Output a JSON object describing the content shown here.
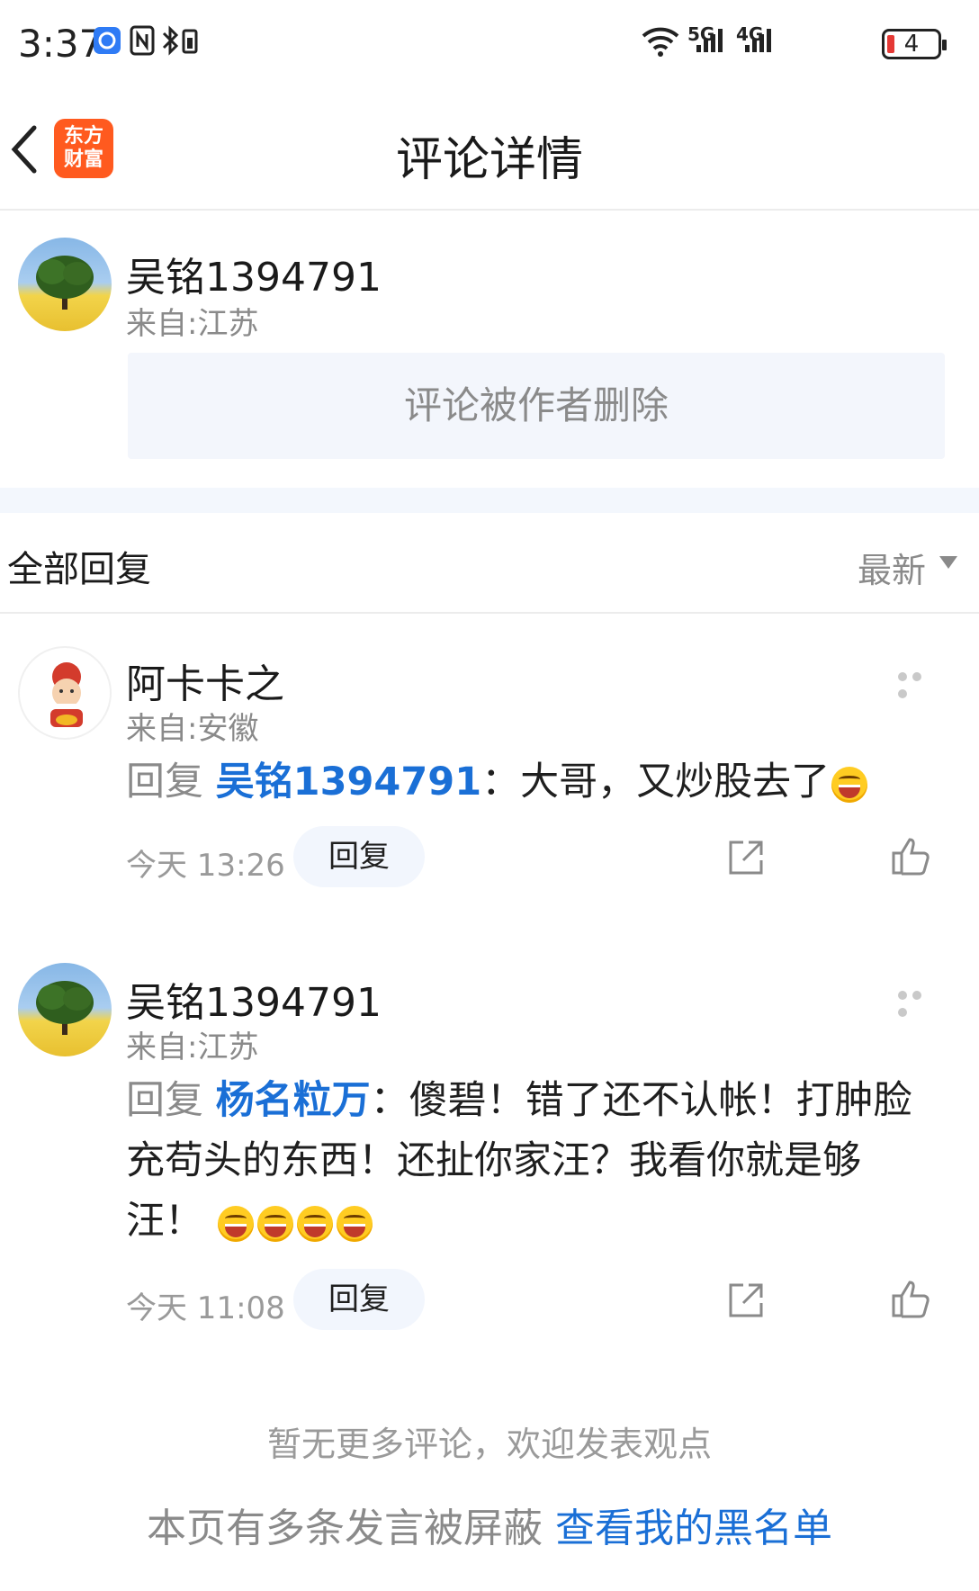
{
  "status_bar": {
    "time": "3:37",
    "network_5g": "5G",
    "network_4g": "4G",
    "battery": "4"
  },
  "header": {
    "app_logo_text_line1": "东方",
    "app_logo_text_line2": "财富",
    "title": "评论详情"
  },
  "main_comment": {
    "author": "吴铭1394791",
    "location": "来自:江苏",
    "content": "评论被作者删除"
  },
  "replies_section": {
    "title": "全部回复",
    "sort": "最新"
  },
  "replies": [
    {
      "author": "阿卡卡之",
      "location": "来自:安徽",
      "prefix": "回复",
      "target": "吴铭1394791",
      "text": "：大哥，又炒股去了",
      "time": "今天 13:26",
      "reply_button": "回复"
    },
    {
      "author": "吴铭1394791",
      "location": "来自:江苏",
      "prefix": "回复",
      "target": "杨名粒万",
      "text": "：傻碧！错了还不认帐！打肿脸充苟头的东西！还扯你家汪？我看你就是够汪！",
      "time": "今天 11:08",
      "reply_button": "回复"
    }
  ],
  "footer": {
    "no_more": "暂无更多评论，欢迎发表观点",
    "blocked_notice": "本页有多条发言被屏蔽",
    "blacklist_link": "查看我的黑名单"
  },
  "colors": {
    "link_blue": "#1a6fd6",
    "brand_orange": "#ff5a1f",
    "muted_gray": "#8a8a8a"
  }
}
